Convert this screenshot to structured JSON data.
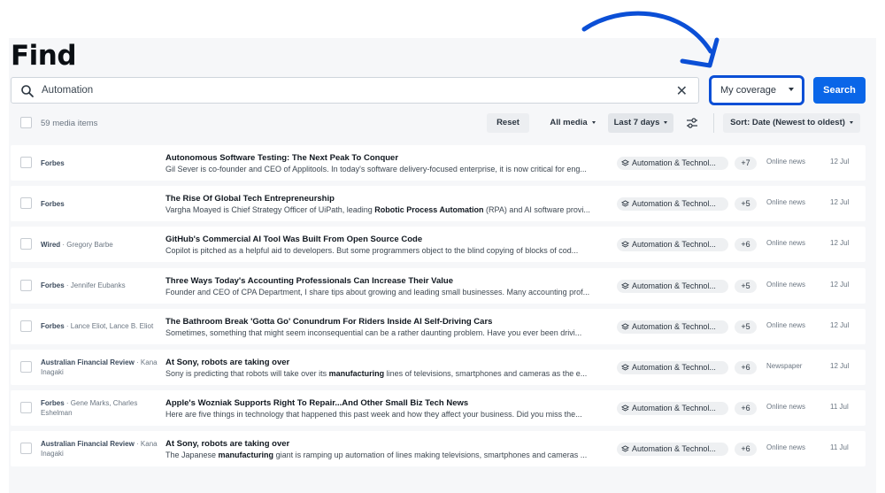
{
  "page": {
    "title": "Find"
  },
  "search": {
    "query": "Automation",
    "clear_icon": "close-icon",
    "button_label": "Search"
  },
  "coverage": {
    "selected": "My coverage"
  },
  "toolbar": {
    "count_label": "59 media items",
    "reset_label": "Reset",
    "media_label": "All media",
    "range_label": "Last 7 days",
    "sort_label": "Sort: Date (Newest to oldest)"
  },
  "colors": {
    "accent": "#0a66e8",
    "highlight_border": "#0b4fd6",
    "arrow": "#0b4fd6"
  },
  "results": [
    {
      "outlet": "Forbes",
      "authors": "",
      "headline": "Autonomous Software Testing: The Next Peak To Conquer",
      "snippet": "Gil Sever is co-founder and CEO of Applitools. In today's software delivery-focused enterprise, it is now critical for eng...",
      "tag": "Automation & Technol...",
      "more": "+7",
      "type": "Online news",
      "date": "12 Jul"
    },
    {
      "outlet": "Forbes",
      "authors": "",
      "headline": "The Rise Of Global Tech Entrepreneurship",
      "snippet_parts": [
        "Vargha Moayed is Chief Strategy Officer of UiPath, leading ",
        "Robotic Process Automation",
        " (RPA) and AI software provi..."
      ],
      "tag": "Automation & Technol...",
      "more": "+5",
      "type": "Online news",
      "date": "12 Jul"
    },
    {
      "outlet": "Wired",
      "authors": "Gregory Barbe",
      "headline": "GitHub's Commercial AI Tool Was Built From Open Source Code",
      "snippet": "Copilot is pitched as a helpful aid to developers. But some programmers object to the blind copying of blocks of cod...",
      "tag": "Automation & Technol...",
      "more": "+6",
      "type": "Online news",
      "date": "12 Jul"
    },
    {
      "outlet": "Forbes",
      "authors": "Jennifer Eubanks",
      "headline": "Three Ways Today's Accounting Professionals Can Increase Their Value",
      "snippet": "Founder and CEO of CPA Department, I share tips about growing and leading small businesses. Many accounting prof...",
      "tag": "Automation & Technol...",
      "more": "+5",
      "type": "Online news",
      "date": "12 Jul"
    },
    {
      "outlet": "Forbes",
      "authors": "Lance Eliot, Lance B. Eliot",
      "headline": "The Bathroom Break 'Gotta Go' Conundrum For Riders Inside AI Self-Driving Cars",
      "snippet": "Sometimes, something that might seem inconsequential can be a rather daunting problem. Have you ever been drivi...",
      "tag": "Automation & Technol...",
      "more": "+5",
      "type": "Online news",
      "date": "12 Jul"
    },
    {
      "outlet": "Australian Financial Review",
      "authors": "Kana Inagaki",
      "headline": "At Sony, robots are taking over",
      "snippet_parts": [
        "Sony is predicting that robots will take over its ",
        "manufacturing",
        " lines of televisions, smartphones and cameras as the e..."
      ],
      "tag": "Automation & Technol...",
      "more": "+6",
      "type": "Newspaper",
      "date": "12 Jul"
    },
    {
      "outlet": "Forbes",
      "authors": "Gene Marks, Charles Eshelman",
      "headline": "Apple's Wozniak Supports Right To Repair...And Other Small Biz Tech News",
      "snippet": "Here are five things in technology that happened this past week and how they affect your business. Did you miss the...",
      "tag": "Automation & Technol...",
      "more": "+6",
      "type": "Online news",
      "date": "11 Jul"
    },
    {
      "outlet": "Australian Financial Review",
      "authors": "Kana Inagaki",
      "headline": "At Sony, robots are taking over",
      "snippet_parts": [
        "The Japanese ",
        "manufacturing",
        " giant is ramping up automation of lines making televisions, smartphones and cameras ..."
      ],
      "tag": "Automation & Technol...",
      "more": "+6",
      "type": "Online news",
      "date": "11 Jul"
    }
  ]
}
